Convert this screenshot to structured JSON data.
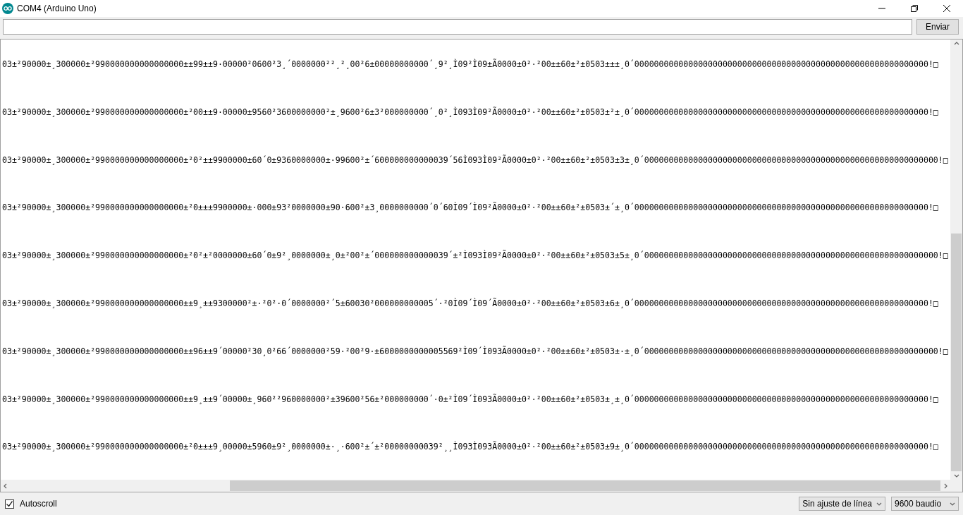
{
  "window": {
    "title": "COM4 (Arduino Uno)"
  },
  "send_bar": {
    "button": "Enviar"
  },
  "output_lines": [
    "03±²90000±¸300000±²990000000000000000±±99±±9·00000²0600²3¸´0000000²²¸²¸00²6±00000000000´¸9²¸Ì09²Ì09±Ã0000±0²·²00±±60±²±0503±±±¸0´000000000000000000000000000000000000000000000000000000000000!□",
    "03±²90000±¸300000±²990000000000000000±²00±±9·00000±9560²3600000000²±¸9600²6±3²000000000´¸0²¸Ì093Ì09²Ã0000±0²·²00±±60±²±0503±²±¸0´000000000000000000000000000000000000000000000000000000000000!□",
    "03±²90000±¸300000±²990000000000000000±²0²±±9900000±60´0±9360000000±·99600²±´600000000000039´56Ì093Ì09²Ã0000±0²·²00±±60±²±0503±3±¸0´000000000000000000000000000000000000000000000000000000000000!□",
    "03±²90000±¸300000±²990000000000000000±²0±±±9900000±·000±93²0000000±90·600²±3¸0000000000´0´60Ì09´Ì09²Ã0000±0²·²00±±60±²±0503±´±¸0´000000000000000000000000000000000000000000000000000000000000!□",
    "03±²90000±¸300000±²990000000000000000±²0²±²0000000±60´0±9²¸0000000±¸0±²00²±´000000000000039´±²Ì093Ì09²Ã0000±0²·²00±±60±²±0503±5±¸0´000000000000000000000000000000000000000000000000000000000000!□",
    "03±²90000±¸300000±²990000000000000000±±9¸±±9300000²±·²0²·0´0000000²´5±60030²000000000005´·²0Ì09´Ì09´Ã0000±0²·²00±±60±²±0503±6±¸0´000000000000000000000000000000000000000000000000000000000000!□",
    "03±²90000±¸300000±²990000000000000000±±96±±9´00000²30¸0²66´0000000²59·²00²9·±6000000000005569²Ì09´Ì093Ã0000±0²·²00±±60±²±0503±·±¸0´000000000000000000000000000000000000000000000000000000000000!□",
    "03±²90000±¸300000±²990000000000000000±±9¸±±9´00000±¸960²²960000000²±39600²56±²000000000´·0±²Ì09´Ì093Ã0000±0²·²00±±60±²±0503±¸±¸0´000000000000000000000000000000000000000000000000000000000000!□",
    "03±²90000±¸300000±²990000000000000000±²0±±±9¸00000±5960±9²¸0000000±·¸·600²±´±²00000000039²¸¸Ì093Ì093Ã0000±0²·²00±±60±²±0503±9±¸0´000000000000000000000000000000000000000000000000000000000000!□"
  ],
  "footer": {
    "autoscroll": {
      "label": "Autoscroll",
      "checked": true
    },
    "line_ending": "Sin ajuste de línea",
    "baud_rate": "9600 baudio"
  }
}
